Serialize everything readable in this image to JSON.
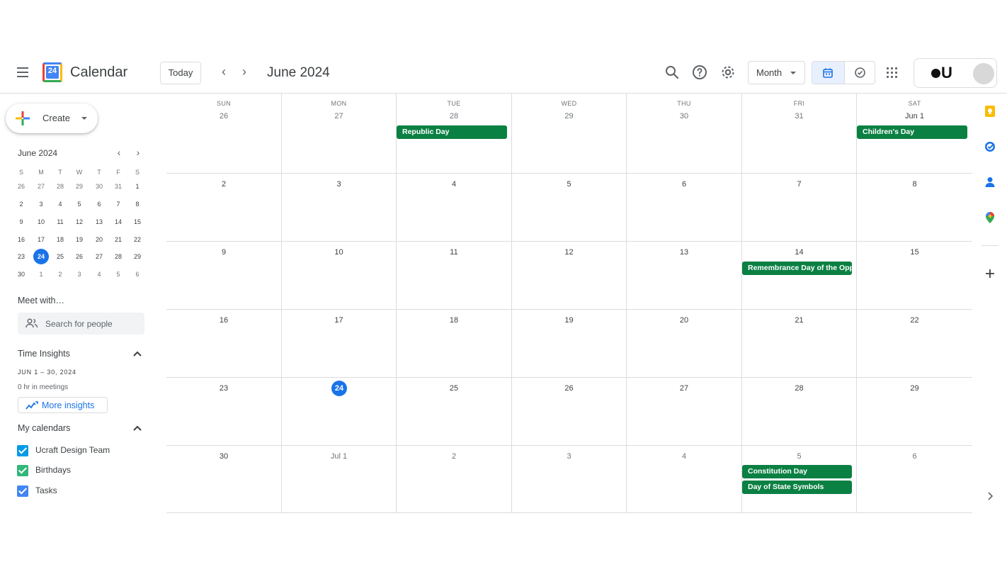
{
  "header": {
    "app_title": "Calendar",
    "logo_number": "24",
    "today_label": "Today",
    "current_month": "June 2024",
    "view_select": "Month",
    "account_logo_text": "U"
  },
  "sidebar": {
    "create_label": "Create",
    "mini_calendar": {
      "title": "June 2024",
      "weekdays": [
        "S",
        "M",
        "T",
        "W",
        "T",
        "F",
        "S"
      ],
      "weeks": [
        [
          "26",
          "27",
          "28",
          "29",
          "30",
          "31",
          "1"
        ],
        [
          "2",
          "3",
          "4",
          "5",
          "6",
          "7",
          "8"
        ],
        [
          "9",
          "10",
          "11",
          "12",
          "13",
          "14",
          "15"
        ],
        [
          "16",
          "17",
          "18",
          "19",
          "20",
          "21",
          "22"
        ],
        [
          "23",
          "24",
          "25",
          "26",
          "27",
          "28",
          "29"
        ],
        [
          "30",
          "1",
          "2",
          "3",
          "4",
          "5",
          "6"
        ]
      ],
      "today": "24"
    },
    "meet_with": "Meet with…",
    "search_people_placeholder": "Search for people",
    "time_insights": {
      "title": "Time Insights",
      "date_range": "JUN 1 – 30, 2024",
      "meetings": "0 hr in meetings",
      "more_label": "More insights"
    },
    "my_calendars": {
      "title": "My calendars",
      "items": [
        {
          "label": "Ucraft Design Team",
          "color": "#039be5"
        },
        {
          "label": "Birthdays",
          "color": "#33b679"
        },
        {
          "label": "Tasks",
          "color": "#4285f4"
        }
      ]
    }
  },
  "grid": {
    "weekdays": [
      "SUN",
      "MON",
      "TUE",
      "WED",
      "THU",
      "FRI",
      "SAT"
    ],
    "weeks": [
      [
        "26",
        "27",
        "28",
        "29",
        "30",
        "31",
        "Jun 1"
      ],
      [
        "2",
        "3",
        "4",
        "5",
        "6",
        "7",
        "8"
      ],
      [
        "9",
        "10",
        "11",
        "12",
        "13",
        "14",
        "15"
      ],
      [
        "16",
        "17",
        "18",
        "19",
        "20",
        "21",
        "22"
      ],
      [
        "23",
        "24",
        "25",
        "26",
        "27",
        "28",
        "29"
      ],
      [
        "30",
        "Jul 1",
        "2",
        "3",
        "4",
        "5",
        "6"
      ]
    ],
    "today": "24",
    "event_color": "#0b8043",
    "events": {
      "republic_day": "Republic Day",
      "childrens_day": "Children's Day",
      "remembrance_day": "Remembrance Day of the Opp",
      "constitution_day": "Constitution Day",
      "state_symbols_day": "Day of State Symbols"
    }
  },
  "rail": {
    "icons": [
      "keep-icon",
      "tasks-icon",
      "contacts-icon",
      "maps-icon",
      "add-icon",
      "expand-icon"
    ]
  }
}
